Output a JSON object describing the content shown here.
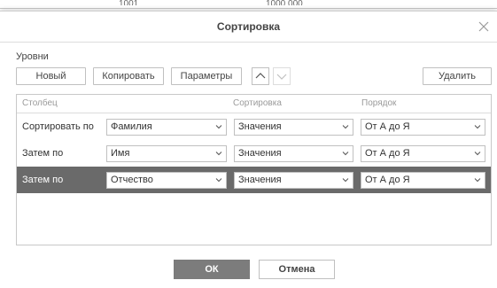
{
  "background": {
    "fragments": [
      "1001",
      "1000 000"
    ]
  },
  "dialog": {
    "title": "Сортировка",
    "close_icon": "close-icon"
  },
  "levels": {
    "label": "Уровни",
    "new_label": "Новый",
    "copy_label": "Копировать",
    "options_label": "Параметры",
    "delete_label": "Удалить",
    "move_up_icon": "chevron-up-icon",
    "move_down_icon": "chevron-down-icon"
  },
  "grid": {
    "headers": {
      "column": "Столбец",
      "sort_on": "Сортировка",
      "order": "Порядок"
    },
    "rows": [
      {
        "label": "Сортировать по",
        "column": "Фамилия",
        "sort_on": "Значения",
        "order": "От А до Я",
        "selected": false
      },
      {
        "label": "Затем по",
        "column": "Имя",
        "sort_on": "Значения",
        "order": "От А до Я",
        "selected": false
      },
      {
        "label": "Затем по",
        "column": "Отчество",
        "sort_on": "Значения",
        "order": "От А до Я",
        "selected": true
      }
    ]
  },
  "footer": {
    "ok_label": "ОК",
    "cancel_label": "Отмена"
  },
  "colors": {
    "selected_row": "#6a6a6a",
    "ok_button": "#7c7c7c"
  }
}
